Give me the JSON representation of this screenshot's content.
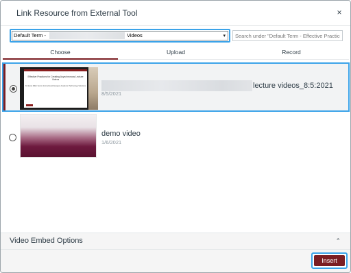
{
  "dialog": {
    "title": "Link Resource from External Tool",
    "close_glyph": "×"
  },
  "filter": {
    "term_prefix": "Default Term -",
    "term_suffix": "Videos",
    "caret": "▾",
    "search_placeholder": "Search under \"Default Term - Effective Practices"
  },
  "tabs": [
    {
      "label": "Choose",
      "selected": true
    },
    {
      "label": "Upload",
      "selected": false
    },
    {
      "label": "Record",
      "selected": false
    }
  ],
  "items": [
    {
      "title_suffix": "lecture videos_8:5:2021",
      "date": "8/5/2021",
      "selected": true,
      "thumb_text": "Effective Practices for Creating Asynchronous Lecture Videos",
      "thumb_small": "Kimberly Miller Senior Instructional Designer Academic Technology Solutions"
    },
    {
      "title": "demo video",
      "date": "1/6/2021",
      "selected": false
    }
  ],
  "footer": {
    "embed_label": "Video Embed Options",
    "embed_chevron": "⌃",
    "insert_label": "Insert"
  },
  "colors": {
    "accent": "#7a1d22",
    "focus": "#3ba3e9"
  },
  "icons": {
    "close": "close-icon",
    "caret": "chevron-down-icon",
    "chevron_up": "chevron-up-icon"
  }
}
